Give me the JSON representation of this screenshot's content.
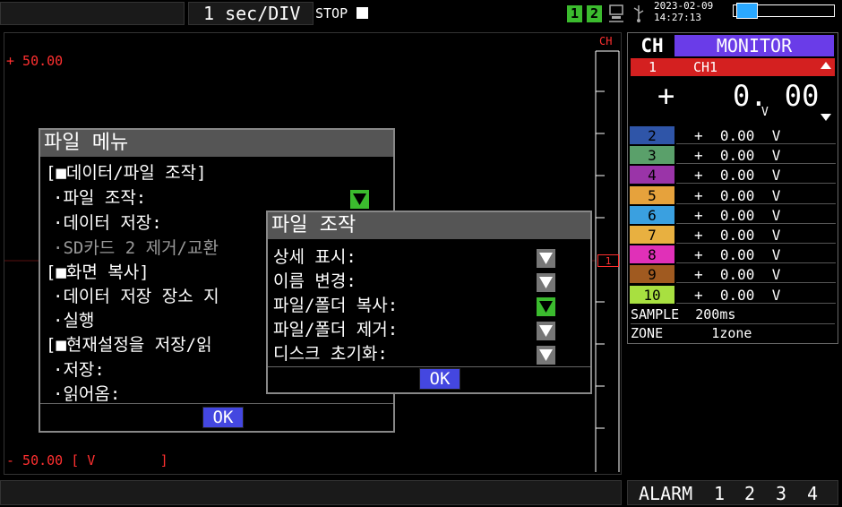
{
  "top": {
    "timebase": "1  sec/DIV",
    "stop_label": "STOP",
    "slot1": "1",
    "slot2": "2",
    "date": "2023-02-09",
    "time": "14:27:13"
  },
  "wave": {
    "upper_label": "+ 50.00",
    "lower_label": "- 50.00 [ V        ]",
    "ch_label": "CH",
    "marker": "1"
  },
  "file_menu": {
    "title": "파일 메뉴",
    "section1": "[■데이터/파일 조작]",
    "item_file_op": "·파일 조작:",
    "item_save": "·데이터 저장:",
    "item_sd": "·SD카드 2 제거/교환",
    "section2": "[■화면 복사]",
    "item_save_loc": "·데이터 저장 장소 지",
    "item_run": "·실행",
    "section3": "[■현재설정을 저장/읽",
    "item_store": "·저장:",
    "item_load": "·읽어옴:",
    "ok": "OK"
  },
  "file_op": {
    "title": "파일 조작",
    "items": [
      "상세 표시:",
      "이름 변경:",
      "파일/폴더 복사:",
      "파일/폴더 제거:",
      "디스크 초기화:"
    ],
    "ok": "OK"
  },
  "panel": {
    "ch_header": "CH",
    "monitor": "MONITOR",
    "ch1_num": "1",
    "ch1_name": "CH1",
    "ch1_sign": "+",
    "ch1_value": "0. 00",
    "ch1_unit": "V",
    "channels": [
      {
        "num": "2",
        "value": "+  0.00  V",
        "color": "#2f55a8"
      },
      {
        "num": "3",
        "value": "+  0.00  V",
        "color": "#5aa06a"
      },
      {
        "num": "4",
        "value": "+  0.00  V",
        "color": "#9a34a8"
      },
      {
        "num": "5",
        "value": "+  0.00  V",
        "color": "#e6a23c"
      },
      {
        "num": "6",
        "value": "+  0.00  V",
        "color": "#3aa0e0"
      },
      {
        "num": "7",
        "value": "+  0.00  V",
        "color": "#e8b040"
      },
      {
        "num": "8",
        "value": "+  0.00  V",
        "color": "#e030b8"
      },
      {
        "num": "9",
        "value": "+  0.00  V",
        "color": "#a05a20"
      },
      {
        "num": "10",
        "value": "+  0.00  V",
        "color": "#a8e040"
      }
    ],
    "sample": "SAMPLE  200ms",
    "zone": "ZONE      1zone"
  },
  "alarm": {
    "label": "ALARM",
    "a1": "1",
    "a2": "2",
    "a3": "3",
    "a4": "4"
  },
  "colors": {
    "ch1_red": "#d42020",
    "monitor_purple": "#6a3ce8",
    "ok_blue": "#4447e0",
    "active_green": "#3bbb2e"
  }
}
